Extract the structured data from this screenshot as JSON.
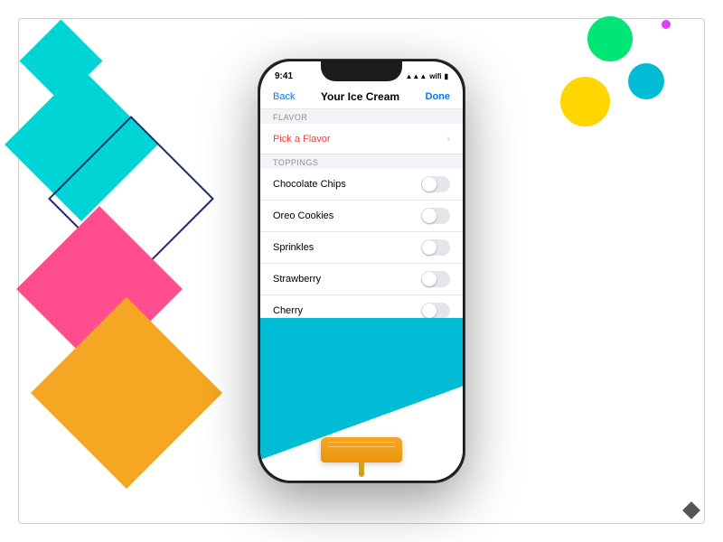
{
  "background": {
    "border_color": "#cccccc"
  },
  "decorative": {
    "shapes": [
      "cyan-square",
      "blue-diamond",
      "pink-square",
      "orange-square",
      "green-circle",
      "yellow-circle",
      "teal-circle",
      "magenta-dot"
    ]
  },
  "phone": {
    "status_bar": {
      "time": "9:41",
      "icons": "▲▲▲"
    },
    "nav": {
      "back_label": "Back",
      "title": "Your Ice Cream",
      "done_label": "Done"
    },
    "sections": [
      {
        "header": "FLAVOR",
        "rows": [
          {
            "label": "Pick a Flavor",
            "type": "chevron",
            "is_flavor": true
          }
        ]
      },
      {
        "header": "TOPPINGS",
        "rows": [
          {
            "label": "Chocolate Chips",
            "type": "toggle",
            "checked": false
          },
          {
            "label": "Oreo Cookies",
            "type": "toggle",
            "checked": false
          },
          {
            "label": "Sprinkles",
            "type": "toggle",
            "checked": false
          },
          {
            "label": "Strawberry",
            "type": "toggle",
            "checked": false
          },
          {
            "label": "Cherry",
            "type": "toggle",
            "checked": false
          }
        ]
      }
    ]
  }
}
